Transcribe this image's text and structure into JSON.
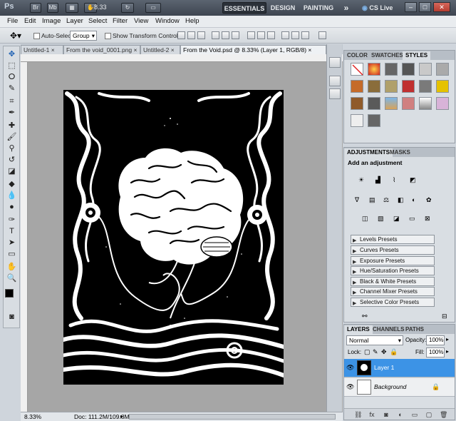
{
  "titlebar": {
    "logo": "Ps",
    "buttons": [
      "Br",
      "Mb",
      "Layer-grid",
      "Hand",
      "Zoom",
      "Rotate",
      "Arrange",
      "Screen"
    ],
    "zoom_value": "8.33",
    "workspaces": [
      "ESSENTIALS",
      "DESIGN",
      "PAINTING"
    ],
    "more": "»",
    "cslive": "CS Live"
  },
  "menu": [
    "File",
    "Edit",
    "Image",
    "Layer",
    "Select",
    "Filter",
    "View",
    "Window",
    "Help"
  ],
  "options": {
    "auto_select_label": "Auto-Select:",
    "auto_select_value": "Group",
    "show_transform_label": "Show Transform Controls"
  },
  "tabs": [
    {
      "label": "Untitled-1",
      "close": "×"
    },
    {
      "label": "From the void_0001.png",
      "close": "×"
    },
    {
      "label": "Untitled-2",
      "close": "×"
    },
    {
      "label": "From the Void.psd @ 8.33% (Layer 1, RGB/8)",
      "close": "×",
      "active": true
    }
  ],
  "status": {
    "zoom": "8.33%",
    "doc": "Doc: 111.2M/109.8M"
  },
  "color_panel": {
    "tabs": [
      "COLOR",
      "SWATCHES",
      "STYLES"
    ],
    "active_tab": "STYLES"
  },
  "adjustments_panel": {
    "tabs": [
      "ADJUSTMENTS",
      "MASKS"
    ],
    "heading": "Add an adjustment",
    "presets": [
      "Levels Presets",
      "Curves Presets",
      "Exposure Presets",
      "Hue/Saturation Presets",
      "Black & White Presets",
      "Channel Mixer Presets",
      "Selective Color Presets"
    ]
  },
  "layers_panel": {
    "tabs": [
      "LAYERS",
      "CHANNELS",
      "PATHS"
    ],
    "blend_mode": "Normal",
    "opacity_label": "Opacity:",
    "opacity_value": "100%",
    "lock_label": "Lock:",
    "fill_label": "Fill:",
    "fill_value": "100%",
    "layers": [
      {
        "name": "Layer 1",
        "selected": true
      },
      {
        "name": "Background",
        "selected": false
      }
    ]
  }
}
